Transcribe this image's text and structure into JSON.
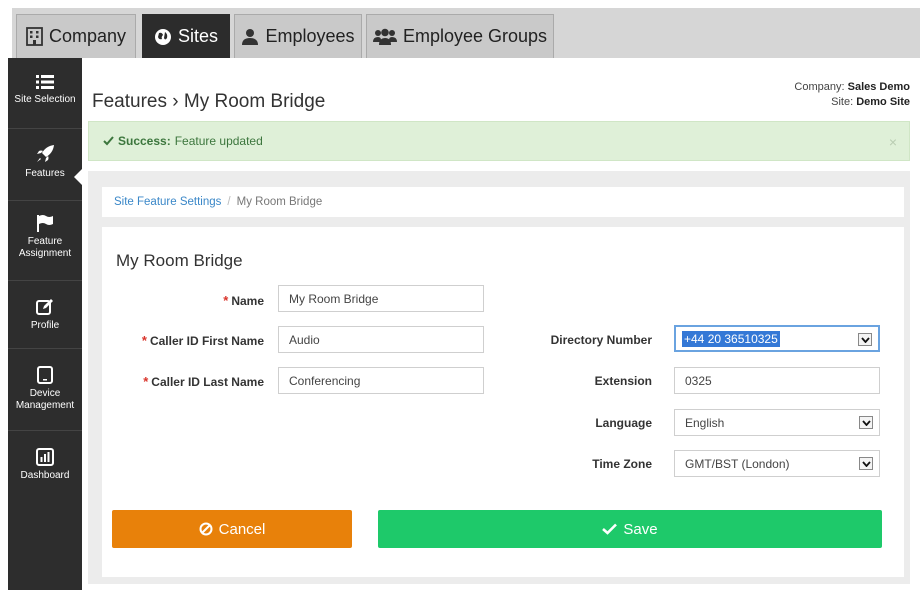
{
  "tabs": [
    {
      "label": "Company",
      "icon": "building-icon"
    },
    {
      "label": "Sites",
      "icon": "globe-icon"
    },
    {
      "label": "Employees",
      "icon": "user-icon"
    },
    {
      "label": "Employee Groups",
      "icon": "users-icon"
    }
  ],
  "sidebar": {
    "items": [
      {
        "label": "Site Selection",
        "icon": "list-icon"
      },
      {
        "label": "Features",
        "icon": "rocket-icon"
      },
      {
        "label": "Feature Assignment",
        "icon": "flag-icon"
      },
      {
        "label": "Profile",
        "icon": "edit-icon"
      },
      {
        "label": "Device Management",
        "icon": "tablet-icon"
      },
      {
        "label": "Dashboard",
        "icon": "bar-chart-icon"
      }
    ]
  },
  "header": {
    "title": "Features › My Room Bridge",
    "company_label": "Company:",
    "company_value": "Sales Demo",
    "site_label": "Site:",
    "site_value": "Demo Site"
  },
  "alert": {
    "strong": "Success:",
    "message": "Feature updated",
    "close": "×",
    "color": "#dff0d8"
  },
  "breadcrumb": {
    "link": "Site Feature Settings",
    "separator": "/",
    "current": "My Room Bridge"
  },
  "form": {
    "title": "My Room Bridge",
    "name_label": "Name",
    "name_value": "My Room Bridge",
    "first_label": "Caller ID First Name",
    "first_value": "Audio",
    "last_label": "Caller ID Last Name",
    "last_value": "Conferencing",
    "dir_label": "Directory Number",
    "dir_value": "+44 20 36510325",
    "ext_label": "Extension",
    "ext_value": "0325",
    "lang_label": "Language",
    "lang_value": "English",
    "tz_label": "Time Zone",
    "tz_value": "GMT/BST (London)",
    "required_mark": "*"
  },
  "buttons": {
    "cancel": "Cancel",
    "save": "Save",
    "cancel_color": "#e8810a",
    "save_color": "#1ec96a"
  }
}
